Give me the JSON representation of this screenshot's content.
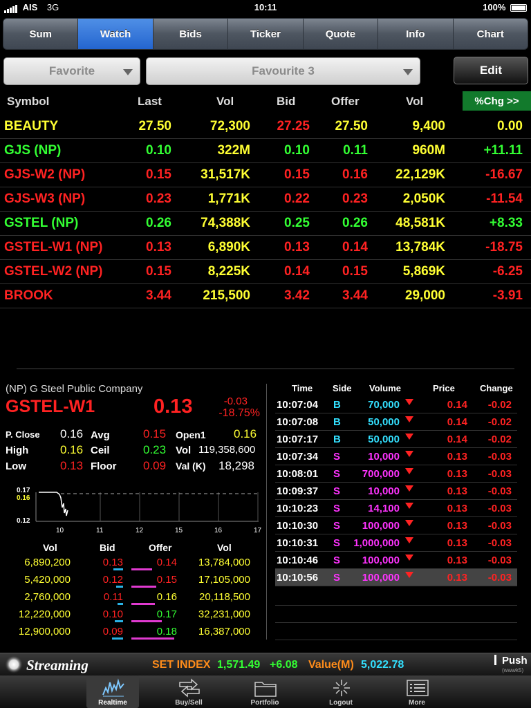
{
  "status_bar": {
    "carrier": "AIS",
    "network": "3G",
    "time": "10:11",
    "battery": "100%"
  },
  "tabs": [
    "Sum",
    "Watch",
    "Bids",
    "Ticker",
    "Quote",
    "Info",
    "Chart"
  ],
  "active_tab": "Watch",
  "filter": {
    "category": "Favorite",
    "list": "Favourite 3",
    "edit_label": "Edit"
  },
  "quote_table": {
    "headers": {
      "symbol": "Symbol",
      "last": "Last",
      "vol": "Vol",
      "bid": "Bid",
      "offer": "Offer",
      "vol2": "Vol",
      "pctchg": "%Chg >>"
    },
    "rows": [
      {
        "symbol": "BEAUTY",
        "last": "27.50",
        "vol": "72,300",
        "bid": "27.25",
        "offer": "27.50",
        "vol2": "9,400",
        "chg": "0.00"
      },
      {
        "symbol": "GJS (NP)",
        "last": "0.10",
        "vol": "322M",
        "bid": "0.10",
        "offer": "0.11",
        "vol2": "960M",
        "chg": "+11.11"
      },
      {
        "symbol": "GJS-W2 (NP)",
        "last": "0.15",
        "vol": "31,517K",
        "bid": "0.15",
        "offer": "0.16",
        "vol2": "22,129K",
        "chg": "-16.67"
      },
      {
        "symbol": "GJS-W3 (NP)",
        "last": "0.23",
        "vol": "1,771K",
        "bid": "0.22",
        "offer": "0.23",
        "vol2": "2,050K",
        "chg": "-11.54"
      },
      {
        "symbol": "GSTEL (NP)",
        "last": "0.26",
        "vol": "74,388K",
        "bid": "0.25",
        "offer": "0.26",
        "vol2": "48,581K",
        "chg": "+8.33"
      },
      {
        "symbol": "GSTEL-W1 (NP)",
        "last": "0.13",
        "vol": "6,890K",
        "bid": "0.13",
        "offer": "0.14",
        "vol2": "13,784K",
        "chg": "-18.75"
      },
      {
        "symbol": "GSTEL-W2 (NP)",
        "last": "0.15",
        "vol": "8,225K",
        "bid": "0.14",
        "offer": "0.15",
        "vol2": "5,869K",
        "chg": "-6.25"
      },
      {
        "symbol": "BROOK",
        "last": "3.44",
        "vol": "215,500",
        "bid": "3.42",
        "offer": "3.44",
        "vol2": "29,000",
        "chg": "-3.91"
      }
    ]
  },
  "detail": {
    "company": "(NP) G Steel Public Company",
    "symbol": "GSTEL-W1",
    "last": "0.13",
    "change": "-0.03",
    "pct_change": "-18.75%",
    "labels": {
      "pclose": "P. Close",
      "avg": "Avg",
      "open1": "Open1",
      "high": "High",
      "ceil": "Ceil",
      "vol": "Vol",
      "low": "Low",
      "floor": "Floor",
      "valk": "Val (K)"
    },
    "values": {
      "pclose": "0.16",
      "avg": "0.15",
      "open1": "0.16",
      "high": "0.16",
      "ceil": "0.23",
      "vol": "119,358,600",
      "low": "0.13",
      "floor": "0.09",
      "valk": "18,298"
    },
    "mini_chart": {
      "y_ticks": [
        "0.17",
        "0.16",
        "0.12"
      ],
      "x_ticks": [
        "10",
        "11",
        "12",
        "15",
        "16",
        "17"
      ]
    },
    "bid_offer": {
      "headers": {
        "vol": "Vol",
        "bid": "Bid",
        "offer": "Offer",
        "vol2": "Vol"
      },
      "rows": [
        {
          "bid_vol": "6,890,200",
          "bid": "0.13",
          "offer": "0.14",
          "offer_vol": "13,784,000"
        },
        {
          "bid_vol": "5,420,000",
          "bid": "0.12",
          "offer": "0.15",
          "offer_vol": "17,105,000"
        },
        {
          "bid_vol": "2,760,000",
          "bid": "0.11",
          "offer": "0.16",
          "offer_vol": "20,118,500"
        },
        {
          "bid_vol": "12,220,000",
          "bid": "0.10",
          "offer": "0.17",
          "offer_vol": "32,231,000"
        },
        {
          "bid_vol": "12,900,000",
          "bid": "0.09",
          "offer": "0.18",
          "offer_vol": "16,387,000"
        }
      ]
    }
  },
  "trades": {
    "headers": {
      "time": "Time",
      "side": "Side",
      "volume": "Volume",
      "price": "Price",
      "change": "Change"
    },
    "rows": [
      {
        "time": "10:07:04",
        "side": "B",
        "volume": "70,000",
        "price": "0.14",
        "change": "-0.02"
      },
      {
        "time": "10:07:08",
        "side": "B",
        "volume": "50,000",
        "price": "0.14",
        "change": "-0.02"
      },
      {
        "time": "10:07:17",
        "side": "B",
        "volume": "50,000",
        "price": "0.14",
        "change": "-0.02"
      },
      {
        "time": "10:07:34",
        "side": "S",
        "volume": "10,000",
        "price": "0.13",
        "change": "-0.03"
      },
      {
        "time": "10:08:01",
        "side": "S",
        "volume": "700,000",
        "price": "0.13",
        "change": "-0.03"
      },
      {
        "time": "10:09:37",
        "side": "S",
        "volume": "10,000",
        "price": "0.13",
        "change": "-0.03"
      },
      {
        "time": "10:10:23",
        "side": "S",
        "volume": "14,100",
        "price": "0.13",
        "change": "-0.03"
      },
      {
        "time": "10:10:30",
        "side": "S",
        "volume": "100,000",
        "price": "0.13",
        "change": "-0.03"
      },
      {
        "time": "10:10:31",
        "side": "S",
        "volume": "1,000,000",
        "price": "0.13",
        "change": "-0.03"
      },
      {
        "time": "10:10:46",
        "side": "S",
        "volume": "100,000",
        "price": "0.13",
        "change": "-0.03"
      },
      {
        "time": "10:10:56",
        "side": "S",
        "volume": "100,000",
        "price": "0.13",
        "change": "-0.03"
      }
    ]
  },
  "streaming_bar": {
    "brand": "Streaming",
    "index_label": "SET INDEX",
    "index_value": "1,571.49",
    "index_change": "+6.08",
    "value_label": "Value(M)",
    "value": "5,022.78",
    "push_label": "Push",
    "push_sub": "(wwwk5)"
  },
  "toolbar": {
    "items": [
      {
        "label": "Realtime",
        "icon": "realtime-chart-icon"
      },
      {
        "label": "Buy/Sell",
        "icon": "buy-sell-arrows-icon"
      },
      {
        "label": "Portfolio",
        "icon": "folder-icon"
      },
      {
        "label": "Logout",
        "icon": "logout-burst-icon"
      },
      {
        "label": "More",
        "icon": "list-icon"
      }
    ],
    "active": "Realtime"
  },
  "colors": {
    "up": "#33ff33",
    "down": "#ff2222",
    "unchanged": "#ffff33",
    "buy": "#33e0ff",
    "sell": "#ff33ff",
    "active_tab": "#2f74dc",
    "pctchg_bg": "#127a2c"
  }
}
